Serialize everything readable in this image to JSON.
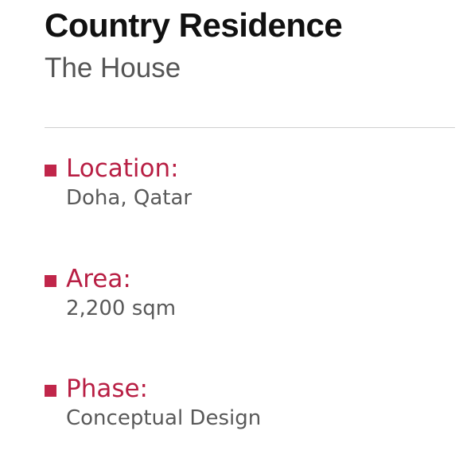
{
  "header": {
    "title": "Country Residence",
    "subtitle": "The House"
  },
  "accent_color": "#c0264a",
  "fields": [
    {
      "label": "Location:",
      "value": "Doha, Qatar"
    },
    {
      "label": "Area:",
      "value": "2,200 sqm"
    },
    {
      "label": "Phase:",
      "value": "Conceptual Design"
    }
  ]
}
